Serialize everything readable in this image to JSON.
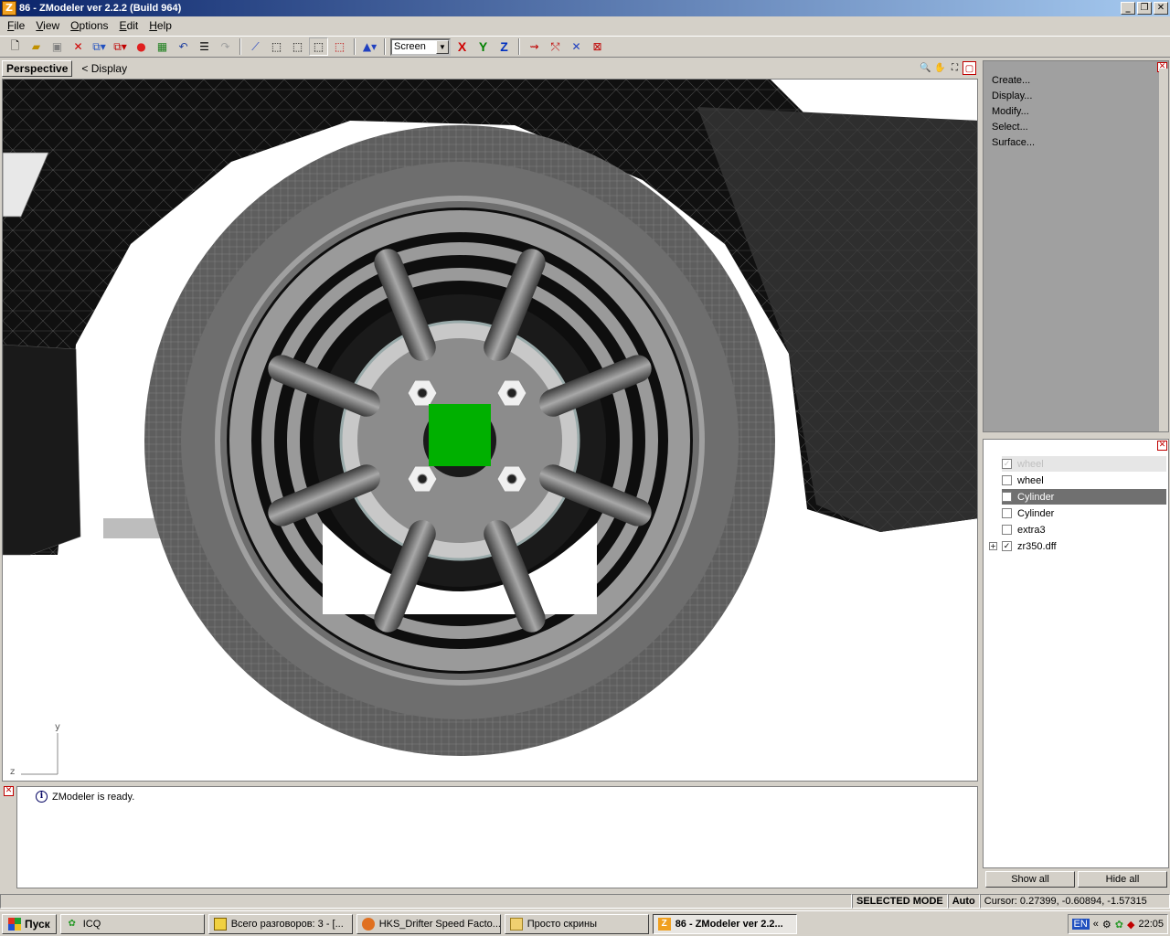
{
  "window": {
    "title": "86 - ZModeler ver 2.2.2 (Build 964)",
    "icon": "Z"
  },
  "menu": [
    "File",
    "View",
    "Options",
    "Edit",
    "Help"
  ],
  "toolbar": {
    "screen_value": "Screen",
    "axis_x": "X",
    "axis_y": "Y",
    "axis_z": "Z"
  },
  "viewport": {
    "name": "Perspective",
    "display_label": "<  Display",
    "axis_y": "y",
    "axis_z": "z"
  },
  "command_panel": {
    "items": [
      "Create...",
      "Display...",
      "Modify...",
      "Select...",
      "Surface..."
    ]
  },
  "tree": {
    "items": [
      {
        "label": "wheel",
        "checked": true
      },
      {
        "label": "wheel",
        "checked": false
      },
      {
        "label": "Cylinder",
        "checked": false
      },
      {
        "label": "Cylinder",
        "checked": false
      },
      {
        "label": "extra3",
        "checked": false
      },
      {
        "label": "zr350.dff",
        "checked": true
      }
    ],
    "show_all": "Show all",
    "hide_all": "Hide all"
  },
  "log": {
    "message": "ZModeler is ready."
  },
  "status": {
    "mode": "SELECTED MODE",
    "auto": "Auto",
    "cursor": "Cursor: 0.27399, -0.60894, -1.57315"
  },
  "taskbar": {
    "start": "Пуск",
    "tasks": [
      "ICQ",
      "Всего разговоров: 3 - [...",
      "HKS_Drifter Speed Facto...",
      "Просто скрины",
      "86 - ZModeler ver 2.2..."
    ],
    "lang": "EN",
    "clock": "22:05"
  },
  "colors": {
    "selection": "#00b000",
    "titlebar": "#0a246a"
  }
}
